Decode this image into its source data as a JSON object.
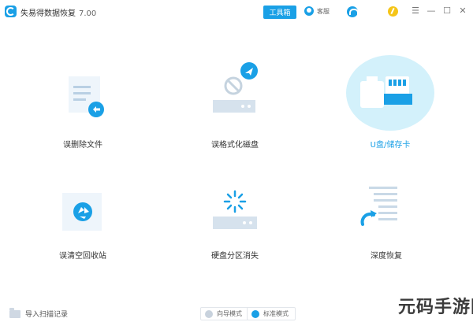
{
  "window": {
    "title": "失易得数据恢复",
    "version": "7.00",
    "pro_label": "工具箱",
    "service_label": "客服"
  },
  "tiles": [
    {
      "label": "误删除文件",
      "icon": "deleted-file-icon"
    },
    {
      "label": "误格式化磁盘",
      "icon": "formatted-disk-icon"
    },
    {
      "label": "U盘/储存卡",
      "icon": "usb-sdcard-icon",
      "active": true
    },
    {
      "label": "误清空回收站",
      "icon": "recycle-bin-icon"
    },
    {
      "label": "硬盘分区消失",
      "icon": "partition-lost-icon"
    },
    {
      "label": "深度恢复",
      "icon": "deep-recovery-icon"
    }
  ],
  "footer": {
    "import_label": "导入扫描记录",
    "guide_mode": "向导模式",
    "standard_mode": "标准模式"
  },
  "watermark": "元码手游网",
  "colors": {
    "accent": "#1aa0e6",
    "halo": "#d3f1fb"
  }
}
